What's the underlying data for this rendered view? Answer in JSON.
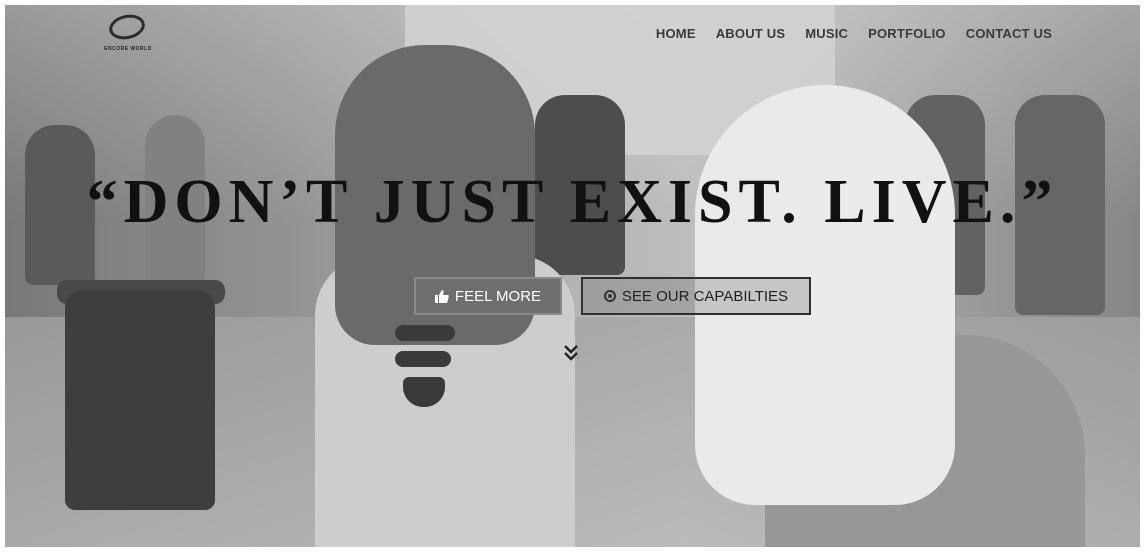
{
  "logo": {
    "text": "ENCORE WORLD"
  },
  "nav": {
    "items": [
      {
        "label": "HOME"
      },
      {
        "label": "ABOUT US"
      },
      {
        "label": "MUSIC"
      },
      {
        "label": "PORTFOLIO"
      },
      {
        "label": "CONTACT US"
      }
    ]
  },
  "hero": {
    "headline": "“DON’T JUST EXIST. LIVE.”",
    "primary_button": {
      "label": "FEEL MORE",
      "icon": "thumbs-up-icon"
    },
    "secondary_button": {
      "label": "SEE OUR CAPABILTIES",
      "icon": "circle-dot-icon"
    },
    "scroll_icon": "double-chevron-down-icon"
  },
  "colors": {
    "headline": "#111111",
    "primary_button_bg": "#6e6e6e",
    "nav_text": "#3a3a3a"
  }
}
